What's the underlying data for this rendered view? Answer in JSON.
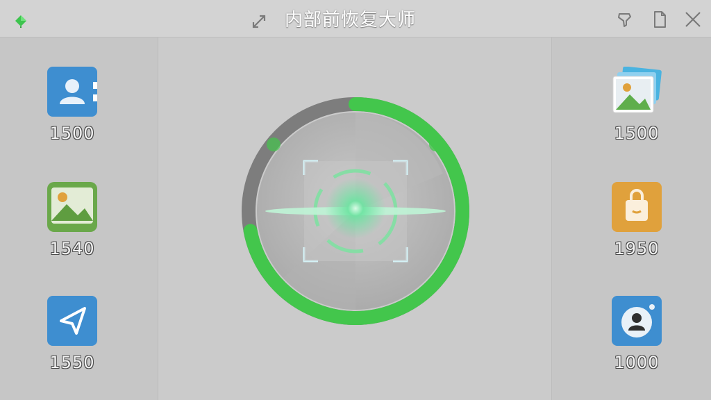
{
  "window": {
    "title": "内部前恢复大师",
    "app_icon": "diamond-app-icon",
    "expand_icon": "expand-arrows-icon",
    "controls": [
      "pin-icon",
      "document-icon",
      "close-icon"
    ]
  },
  "categories_left": [
    {
      "id": "contacts",
      "icon": "contacts-icon",
      "count": "1500",
      "color": "#3e8ed0"
    },
    {
      "id": "photos",
      "icon": "photos-icon",
      "count": "1540",
      "color": "#6fb04a"
    },
    {
      "id": "messages",
      "icon": "paper-plane-icon",
      "count": "1550",
      "color": "#3e8ed0"
    }
  ],
  "categories_right": [
    {
      "id": "gallery",
      "icon": "photo-stack-icon",
      "count": "1500",
      "color": "#4ab3e0"
    },
    {
      "id": "apps",
      "icon": "shopping-bag-icon",
      "count": "1950",
      "color": "#e0a13c"
    },
    {
      "id": "wechat",
      "icon": "chat-avatar-icon",
      "count": "1000",
      "color": "#3e8ed0"
    }
  ],
  "scanner": {
    "progress": 0.72,
    "ring_color": "#43c64c",
    "track_color": "#7d7d7d",
    "icon": "face-scan-icon"
  }
}
